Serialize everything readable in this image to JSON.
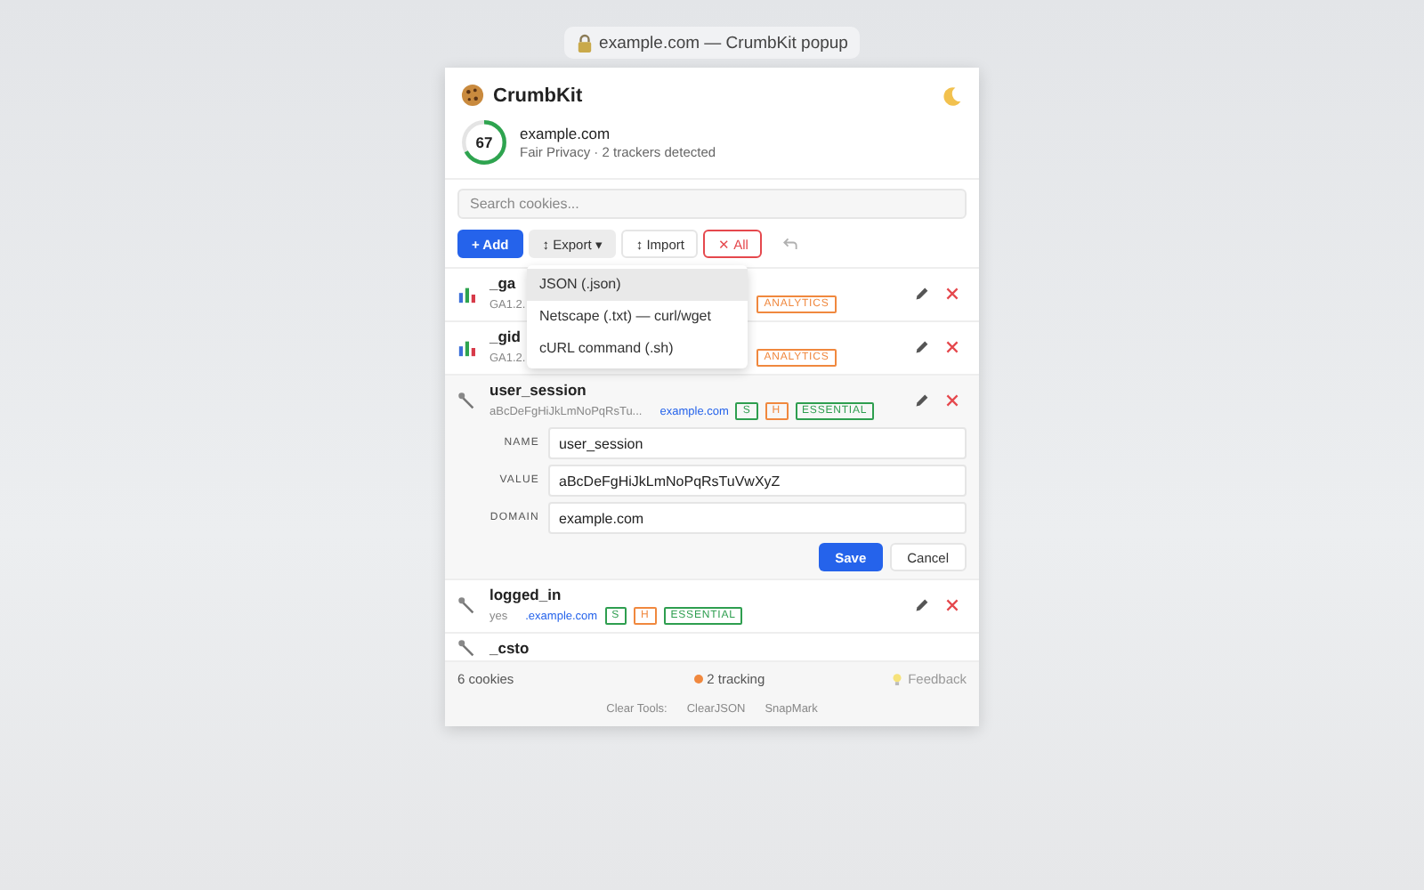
{
  "window": {
    "title": "example.com — CrumbKit popup"
  },
  "header": {
    "app_name": "CrumbKit"
  },
  "site": {
    "score": "67",
    "domain": "example.com",
    "summary": "Fair Privacy · 2 trackers detected"
  },
  "search": {
    "placeholder": "Search cookies..."
  },
  "toolbar": [
    {
      "kind": "primary",
      "label": "+ Add"
    },
    {
      "kind": "menu",
      "label": "↕ Export ▾"
    },
    {
      "kind": "plain",
      "label": "↕ Import"
    },
    {
      "kind": "danger",
      "label": "✕ All"
    }
  ],
  "export_menu": [
    {
      "label": "JSON (.json)",
      "selected": true
    },
    {
      "label": "Netscape (.txt) — curl/wget",
      "selected": false
    },
    {
      "label": "cURL command (.sh)",
      "selected": false
    }
  ],
  "cookies": [
    {
      "kind": "chart",
      "name": "_ga",
      "value": "GA1.2.",
      "tags": [
        {
          "label": "ANALYTICS",
          "color": "#f0883e"
        }
      ],
      "expanded": false
    },
    {
      "kind": "chart",
      "name": "_gid",
      "value": "GA1.2.",
      "tags": [
        {
          "label": "ANALYTICS",
          "color": "#f0883e"
        }
      ],
      "expanded": false
    },
    {
      "kind": "wrench",
      "name": "user_session",
      "value": "aBcDeFgHiJkLmNoPqRsTu...",
      "domain": "example.com",
      "tags": [
        {
          "label": "S",
          "color": "#2e9e4f"
        },
        {
          "label": "H",
          "color": "#f0883e"
        },
        {
          "label": "ESSENTIAL",
          "color": "#2e9e4f"
        }
      ],
      "expanded": true
    },
    {
      "kind": "wrench",
      "name": "logged_in",
      "value": "yes",
      "domain": ".example.com",
      "tags": [
        {
          "label": "S",
          "color": "#2e9e4f"
        },
        {
          "label": "H",
          "color": "#f0883e"
        },
        {
          "label": "ESSENTIAL",
          "color": "#2e9e4f"
        }
      ],
      "expanded": false
    },
    {
      "kind": "wrench",
      "name": "_csto",
      "expanded": false
    }
  ],
  "editor": {
    "fields": [
      {
        "label": "NAME",
        "value": "user_session"
      },
      {
        "label": "VALUE",
        "value": "aBcDeFgHiJkLmNoPqRsTuVwXyZ"
      },
      {
        "label": "DOMAIN",
        "value": "example.com"
      }
    ],
    "save": "Save",
    "cancel": "Cancel"
  },
  "footer": {
    "count": "6 cookies",
    "tracking": "2 tracking",
    "feedback": "Feedback",
    "tools_label": "Clear Tools:",
    "tools": [
      "ClearJSON",
      "SnapMark"
    ]
  }
}
